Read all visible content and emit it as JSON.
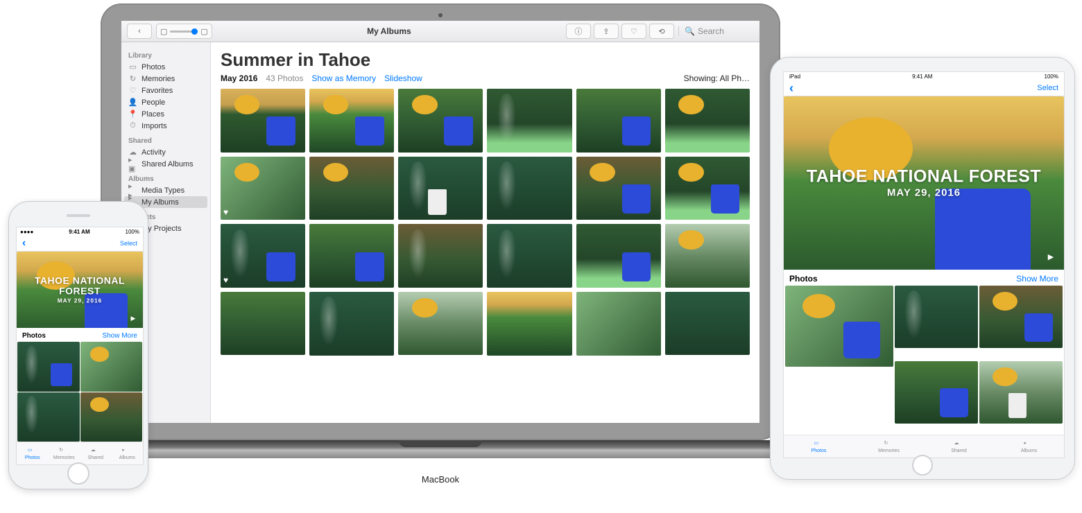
{
  "macbook": {
    "logo": "MacBook",
    "toolbar": {
      "title": "My Albums",
      "back_icon": "chevron-left",
      "view_icons": [
        "grid",
        "square"
      ],
      "right_icons": [
        "info",
        "share",
        "favorite",
        "rotate"
      ],
      "search_placeholder": "Search"
    },
    "sidebar": {
      "sections": [
        {
          "heading": "Library",
          "items": [
            {
              "icon": "photos",
              "label": "Photos"
            },
            {
              "icon": "memories",
              "label": "Memories"
            },
            {
              "icon": "favorite",
              "label": "Favorites"
            },
            {
              "icon": "people",
              "label": "People"
            },
            {
              "icon": "places",
              "label": "Places"
            },
            {
              "icon": "imports",
              "label": "Imports"
            }
          ]
        },
        {
          "heading": "Shared",
          "items": [
            {
              "icon": "cloud",
              "label": "Activity"
            },
            {
              "icon": "shared",
              "label": "Shared Albums",
              "disclosure": true
            }
          ]
        },
        {
          "heading": "Albums",
          "items": [
            {
              "icon": "media",
              "label": "Media Types",
              "disclosure": true
            },
            {
              "icon": "albums",
              "label": "My Albums",
              "disclosure": true,
              "selected": true
            }
          ]
        },
        {
          "heading": "Projects",
          "items": [
            {
              "icon": "projects",
              "label": "My Projects",
              "disclosure": true
            }
          ]
        }
      ]
    },
    "main": {
      "title": "Summer in Tahoe",
      "date": "May 2016",
      "count": "43 Photos",
      "link_memory": "Show as Memory",
      "link_slideshow": "Slideshow",
      "showing": "Showing: All Ph…",
      "photos": [
        {
          "c": "p1 yel-spot blue-spot"
        },
        {
          "c": "p2 yel-spot blue-spot"
        },
        {
          "c": "p4 yel-spot blue-spot"
        },
        {
          "c": "p3 leaf"
        },
        {
          "c": "p4 blue-spot"
        },
        {
          "c": "p3 leaf yel-spot"
        },
        {
          "c": "p7 yel-spot",
          "fav": true
        },
        {
          "c": "p6 yel-spot"
        },
        {
          "c": "p8 leaf wht-spot"
        },
        {
          "c": "p8 leaf"
        },
        {
          "c": "p6 blue-spot yel-spot"
        },
        {
          "c": "p3 yel-spot blue-spot"
        },
        {
          "c": "p8 leaf blue-spot",
          "fav": true
        },
        {
          "c": "p4 blue-spot"
        },
        {
          "c": "p6 leaf"
        },
        {
          "c": "p8 leaf"
        },
        {
          "c": "p3 blue-spot"
        },
        {
          "c": "p5 yel-spot"
        },
        {
          "c": "p4"
        },
        {
          "c": "p8 leaf"
        },
        {
          "c": "p5 yel-spot"
        },
        {
          "c": "p2"
        },
        {
          "c": "p7"
        },
        {
          "c": "p8"
        }
      ]
    }
  },
  "iphone": {
    "status": {
      "carrier": "●●●● ",
      "time": "9:41 AM",
      "battery": "100%"
    },
    "nav": {
      "back": "‹",
      "select": "Select"
    },
    "hero": {
      "title": "TAHOE NATIONAL FOREST",
      "subtitle": "MAY 29, 2016"
    },
    "section": {
      "title": "Photos",
      "more": "Show More"
    },
    "thumbs": [
      {
        "c": "p8 leaf blue-spot"
      },
      {
        "c": "p7 yel-spot"
      },
      {
        "c": "p8 leaf"
      },
      {
        "c": "p6 yel-spot"
      }
    ],
    "tabs": [
      {
        "icon": "photos",
        "label": "Photos",
        "active": true
      },
      {
        "icon": "memories",
        "label": "Memories"
      },
      {
        "icon": "cloud",
        "label": "Shared"
      },
      {
        "icon": "albums",
        "label": "Albums"
      }
    ]
  },
  "ipad": {
    "status": {
      "left": "iPad ",
      "time": "9:41 AM",
      "battery": "100%"
    },
    "nav": {
      "back": "‹",
      "select": "Select"
    },
    "hero": {
      "title": "TAHOE NATIONAL FOREST",
      "subtitle": "MAY 29, 2016"
    },
    "section": {
      "title": "Photos",
      "more": "Show More"
    },
    "thumbs": [
      {
        "c": "p7 yel-spot blue-spot",
        "big": true
      },
      {
        "c": "p8 leaf"
      },
      {
        "c": "p6 yel-spot blue-spot"
      },
      {
        "c": "p4 blue-spot"
      },
      {
        "c": "p5 yel-spot wht-spot"
      }
    ],
    "tabs": [
      {
        "icon": "photos",
        "label": "Photos",
        "active": true
      },
      {
        "icon": "memories",
        "label": "Memories"
      },
      {
        "icon": "cloud",
        "label": "Shared"
      },
      {
        "icon": "albums",
        "label": "Albums"
      }
    ]
  },
  "icons": {
    "photos": "▭",
    "memories": "↻",
    "favorite": "♡",
    "people": "👤",
    "places": "📍",
    "imports": "⏱",
    "cloud": "☁",
    "shared": "▣",
    "media": "▸",
    "albums": "▸",
    "projects": "▸",
    "info": "ⓘ",
    "share": "⇪",
    "rotate": "⟲",
    "grid": "▦",
    "square": "▢",
    "chevron-left": "‹",
    "search": "🔍"
  }
}
